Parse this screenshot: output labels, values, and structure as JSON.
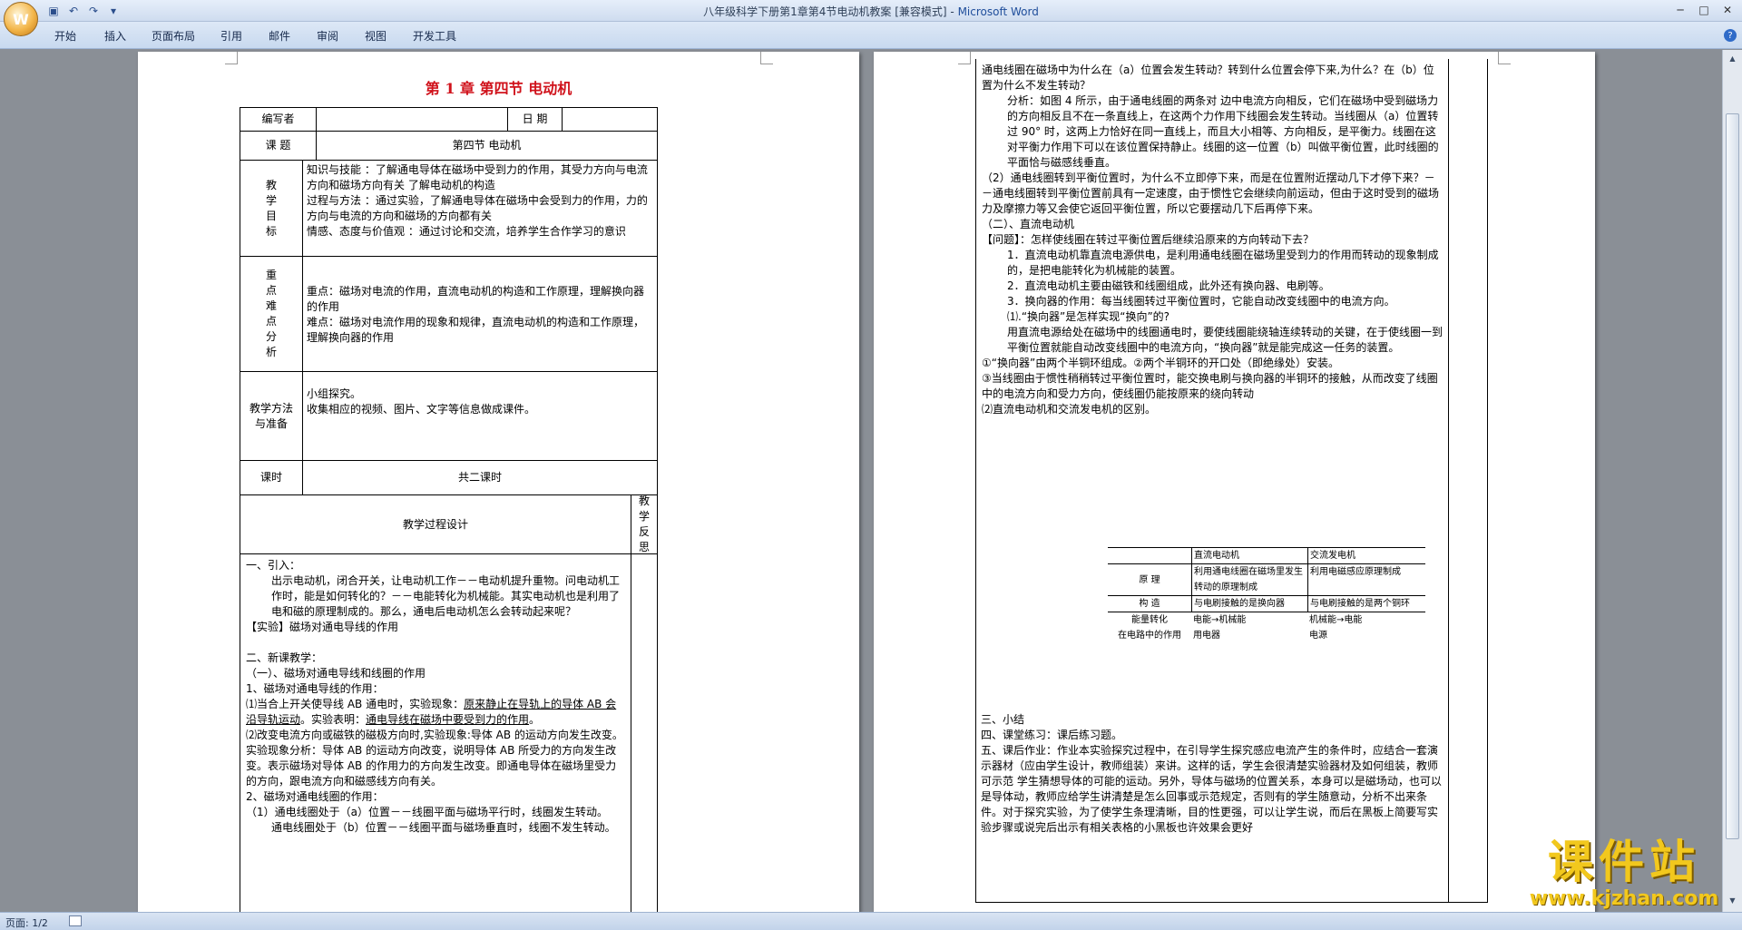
{
  "window": {
    "title_doc": "八年级科学下册第1章第4节电动机教案 [兼容模式] - ",
    "title_app": "Microsoft Word"
  },
  "ribbon": {
    "tabs": [
      "开始",
      "插入",
      "页面布局",
      "引用",
      "邮件",
      "审阅",
      "视图",
      "开发工具"
    ]
  },
  "status": {
    "page_info": "页面: 1/2"
  },
  "watermark": {
    "main": "课件站",
    "url": "www.kjzhan.com"
  },
  "page1": {
    "title": "第 1 章  第四节  电动机",
    "author_label": "编写者",
    "date_label": "日  期",
    "topic_label": "课    题",
    "topic_value": "第四节    电动机",
    "goals_label": [
      "教",
      "学",
      "目",
      "标"
    ],
    "goals": [
      "知识与技能  ：了解通电导体在磁场中受到力的作用，其受力方向与电流方向和磁场方向有关 了解电动机的构造",
      "过程与方法  ：通过实验，了解通电导体在磁场中会受到力的作用，力的方向与电流的方向和磁场的方向都有关",
      "情感、态度与价值观 ：通过讨论和交流，培养学生合作学习的意识"
    ],
    "key_label": [
      "重",
      "点",
      "难",
      "点",
      "分",
      "析"
    ],
    "key_points": [
      "重点：磁场对电流的作用，直流电动机的构造和工作原理，理解换向器的作用",
      "难点：磁场对电流作用的现象和规律，直流电动机的构造和工作原理，理解换向器的作用"
    ],
    "method_label": "教学方法与准备",
    "methods": [
      "小组探究。",
      "收集相应的视频、图片、文字等信息做成课件。"
    ],
    "hours_label": "课时",
    "hours_value": "共二课时",
    "design_label": "教学过程设计",
    "reflect_label": "教学反思",
    "body": [
      "一、引入：",
      "出示电动机，闭合开关，让电动机工作－－电动机提升重物。问电动机工作时，能是如何转化的？－－电能转化为机械能。其实电动机也是利用了电和磁的原理制成的。那么，通电后电动机怎么会转动起来呢？",
      "【实验】磁场对通电导线的作用",
      "二、新课教学：",
      "（一）、磁场对通电导线和线圈的作用",
      "1、磁场对通电导线的作用：",
      "⑴当合上开关使导线 AB 通电时，实验现象：",
      "原来静止在导轨上的导体 AB 会沿导轨运动",
      "。实验表明：",
      "通电导线在磁场中要受到力的作用",
      "。",
      "⑵改变电流方向或磁铁的磁极方向时,实验现象:导体 AB 的运动方向发生改变。实验现象分析：导体 AB 的运动方向改变，说明导体 AB 所受力的方向发生改变。表示磁场对导体 AB 的作用力的方向发生改变。即通电导体在磁场里受力的方向，跟电流方向和磁感线方向有关。",
      "2、磁场对通电线圈的作用：",
      "（1）通电线圈处于（a）位置－－线圈平面与磁场平行时，线圈发生转动。",
      "通电线圈处于（b）位置－－线圈平面与磁场垂直时，线圈不发生转动。"
    ]
  },
  "page2": {
    "body": [
      "通电线圈在磁场中为什么在（a）位置会发生转动？转到什么位置会停下来,为什么？在（b）位置为什么不发生转动？",
      "分析：如图 4 所示，由于通电线圈的两条对 边中电流方向相反，它们在磁场中受到磁场力的方向相反且不在一条直线上，在这两个力作用下线圈会发生转动。当线圈从（a）位置转过 90° 时，这两上力恰好在同一直线上，而且大小相等、方向相反，是平衡力。线圈在这对平衡力作用下可以在该位置保持静止。线圈的这一位置（b）叫做平衡位置，此时线圈的平面恰与磁感线垂直。",
      "（2）通电线圈转到平衡位置时，为什么不立即停下来，而是在位置附近摆动几下才停下来？－－通电线圈转到平衡位置前具有一定速度，由于惯性它会继续向前运动，但由于这时受到的磁场力及摩擦力等又会使它返回平衡位置，所以它要摆动几下后再停下来。",
      "（二）、直流电动机",
      "【问题】：怎样使线圈在转过平衡位置后继续沿原来的方向转动下去？",
      "1．直流电动机靠直流电源供电，是利用通电线圈在磁场里受到力的作用而转动的现象制成的，是把电能转化为机械能的装置。",
      "2．直流电动机主要由磁铁和线圈组成，此外还有换向器、电刷等。",
      "3．换向器的作用：每当线圈转过平衡位置时，它能自动改变线圈中的电流方向。",
      "⑴.“换向器”是怎样实现“换向”的?",
      "用直流电源给处在磁场中的线圈通电时，要使线圈能绕轴连续转动的关键，在于使线圈一到平衡位置就能自动改变线圈中的电流方向，“换向器”就是能完成这一任务的装置。",
      "①“换向器”由两个半铜环组成。②两个半铜环的开口处（即绝缘处）安装。",
      "③当线圈由于惯性稍稍转过平衡位置时，能交换电刷与换向器的半铜环的接触，从而改变了线圈中的电流方向和受力方向，使线圈仍能按原来的绕向转动",
      "⑵直流电动机和交流发电机的区别。",
      "三、小结",
      "四、课堂练习：课后练习题。",
      "五、课后作业：作业本实验探究过程中，在引导学生探究感应电流产生的条件时，应结合一套演示器材（应由学生设计，教师组装）来讲。这样的话，学生会很清楚实验器材及如何组装，教师可示范 学生猜想导体的可能的运动。另外，导体与磁场的位置关系，本身可以是磁场动，也可以是导体动，教师应给学生讲清楚是怎么回事或示范规定，否则有的学生随意动，分析不出来条件。对于探究实验，为了使学生条理清晰，目的性更强，可以让学生说，而后在黑板上简要写实验步骤或说完后出示有相关表格的小黑板也许效果会更好"
    ],
    "compare": {
      "headers": [
        "",
        "直流电动机",
        "交流发电机"
      ],
      "rows": [
        [
          "原    理",
          "利用通电线圈在磁场里发生转动的原理制成",
          "利用电磁感应原理制成"
        ],
        [
          "构    造",
          "与电刷接触的是换向器",
          "与电刷接触的是两个铜环"
        ],
        [
          "能量转化",
          "电能→机械能",
          "机械能→电能"
        ],
        [
          "在电路中的作用",
          "用电器",
          "电源"
        ]
      ]
    }
  }
}
